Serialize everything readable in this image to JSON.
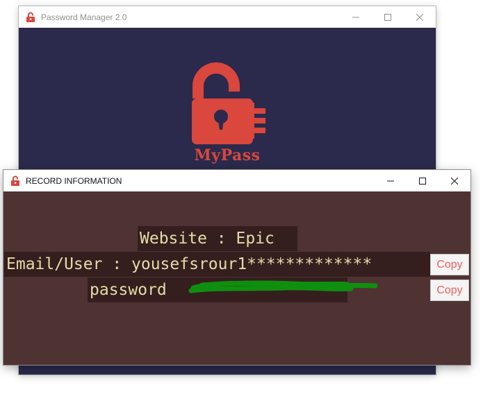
{
  "main_window": {
    "title": "Password Manager 2.0",
    "logo_text": "MyPass",
    "colors": {
      "background": "#2b2a4c",
      "logo": "#d9473d"
    }
  },
  "record_window": {
    "title": "RECORD INFORMATION",
    "website_label": "Website : Epic",
    "email_label": "Email/User : yousefsrour1*************",
    "password_label": "password",
    "copy_email_label": "Copy",
    "copy_password_label": "Copy",
    "colors": {
      "background": "#4f3333",
      "label_background": "#351e1e",
      "label_text": "#e8dba8",
      "copy_text": "#f06060",
      "redaction": "#0f8f0f"
    }
  },
  "icons": {
    "app_icon": "lock-icon",
    "minimize": "minimize-icon",
    "maximize": "maximize-icon",
    "close": "close-icon"
  }
}
